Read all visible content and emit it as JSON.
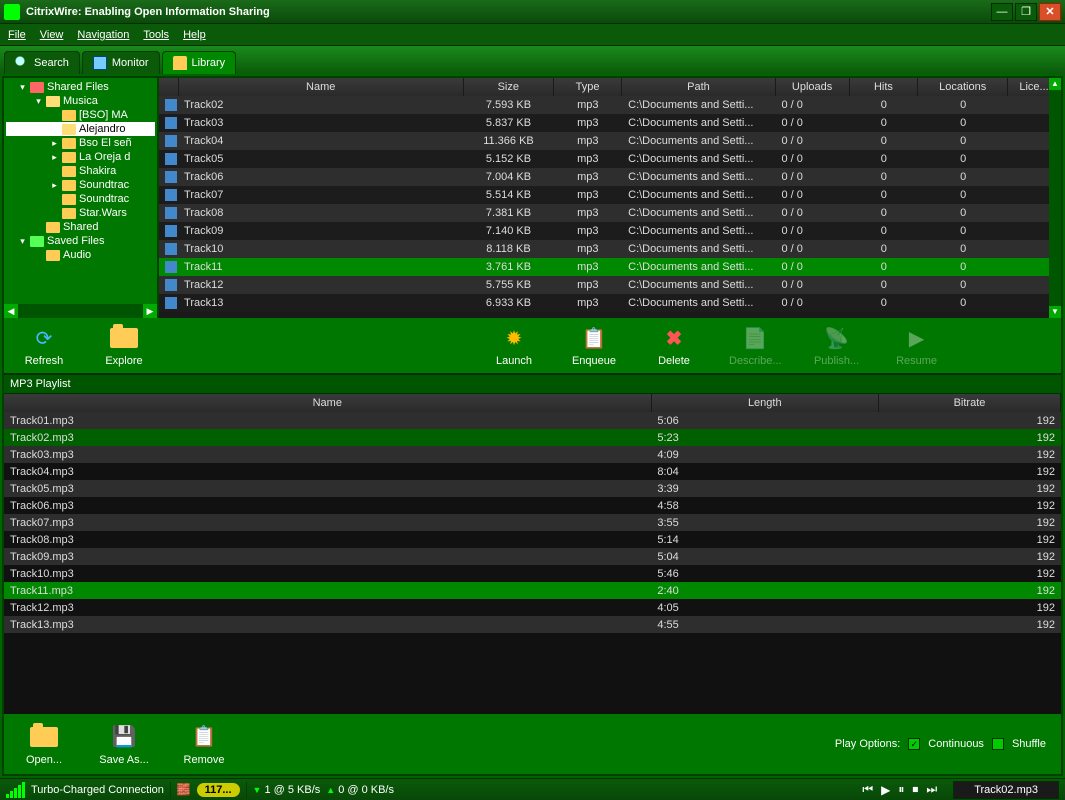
{
  "title": "CitrixWire: Enabling Open Information Sharing",
  "menu": {
    "file": "File",
    "view": "View",
    "nav": "Navigation",
    "tools": "Tools",
    "help": "Help"
  },
  "tabs": {
    "search": "Search",
    "monitor": "Monitor",
    "library": "Library"
  },
  "tree": {
    "shared": "Shared Files",
    "musica": "Musica",
    "bso": "[BSO] MA",
    "alejandro": "Alejandro",
    "bsoel": "Bso El señ",
    "laoreja": "La Oreja d",
    "shakira": "Shakira",
    "st1": "Soundtrac",
    "st2": "Soundtrac",
    "starwars": "Star.Wars",
    "shared2": "Shared",
    "saved": "Saved Files",
    "audio": "Audio"
  },
  "fileCols": {
    "name": "Name",
    "size": "Size",
    "type": "Type",
    "path": "Path",
    "uploads": "Uploads",
    "hits": "Hits",
    "locations": "Locations",
    "lice": "Lice..."
  },
  "files": [
    {
      "n": "Track02",
      "s": "7.593 KB",
      "t": "mp3",
      "p": "C:\\Documents and Setti...",
      "u": "0 / 0",
      "h": "0",
      "l": "0"
    },
    {
      "n": "Track03",
      "s": "5.837 KB",
      "t": "mp3",
      "p": "C:\\Documents and Setti...",
      "u": "0 / 0",
      "h": "0",
      "l": "0"
    },
    {
      "n": "Track04",
      "s": "11.366 KB",
      "t": "mp3",
      "p": "C:\\Documents and Setti...",
      "u": "0 / 0",
      "h": "0",
      "l": "0"
    },
    {
      "n": "Track05",
      "s": "5.152 KB",
      "t": "mp3",
      "p": "C:\\Documents and Setti...",
      "u": "0 / 0",
      "h": "0",
      "l": "0"
    },
    {
      "n": "Track06",
      "s": "7.004 KB",
      "t": "mp3",
      "p": "C:\\Documents and Setti...",
      "u": "0 / 0",
      "h": "0",
      "l": "0"
    },
    {
      "n": "Track07",
      "s": "5.514 KB",
      "t": "mp3",
      "p": "C:\\Documents and Setti...",
      "u": "0 / 0",
      "h": "0",
      "l": "0"
    },
    {
      "n": "Track08",
      "s": "7.381 KB",
      "t": "mp3",
      "p": "C:\\Documents and Setti...",
      "u": "0 / 0",
      "h": "0",
      "l": "0"
    },
    {
      "n": "Track09",
      "s": "7.140 KB",
      "t": "mp3",
      "p": "C:\\Documents and Setti...",
      "u": "0 / 0",
      "h": "0",
      "l": "0"
    },
    {
      "n": "Track10",
      "s": "8.118 KB",
      "t": "mp3",
      "p": "C:\\Documents and Setti...",
      "u": "0 / 0",
      "h": "0",
      "l": "0"
    },
    {
      "n": "Track11",
      "s": "3.761 KB",
      "t": "mp3",
      "p": "C:\\Documents and Setti...",
      "u": "0 / 0",
      "h": "0",
      "l": "0",
      "sel": true
    },
    {
      "n": "Track12",
      "s": "5.755 KB",
      "t": "mp3",
      "p": "C:\\Documents and Setti...",
      "u": "0 / 0",
      "h": "0",
      "l": "0"
    },
    {
      "n": "Track13",
      "s": "6.933 KB",
      "t": "mp3",
      "p": "C:\\Documents and Setti...",
      "u": "0 / 0",
      "h": "0",
      "l": "0"
    }
  ],
  "btns": {
    "refresh": "Refresh",
    "explore": "Explore",
    "launch": "Launch",
    "enqueue": "Enqueue",
    "delete": "Delete",
    "describe": "Describe...",
    "publish": "Publish...",
    "resume": "Resume"
  },
  "playlist": {
    "hdr": "MP3 Playlist",
    "cols": {
      "name": "Name",
      "length": "Length",
      "bitrate": "Bitrate"
    },
    "rows": [
      {
        "n": "Track01.mp3",
        "l": "5:06",
        "b": "192"
      },
      {
        "n": "Track02.mp3",
        "l": "5:23",
        "b": "192",
        "cur": true
      },
      {
        "n": "Track03.mp3",
        "l": "4:09",
        "b": "192"
      },
      {
        "n": "Track04.mp3",
        "l": "8:04",
        "b": "192"
      },
      {
        "n": "Track05.mp3",
        "l": "3:39",
        "b": "192"
      },
      {
        "n": "Track06.mp3",
        "l": "4:58",
        "b": "192"
      },
      {
        "n": "Track07.mp3",
        "l": "3:55",
        "b": "192"
      },
      {
        "n": "Track08.mp3",
        "l": "5:14",
        "b": "192"
      },
      {
        "n": "Track09.mp3",
        "l": "5:04",
        "b": "192"
      },
      {
        "n": "Track10.mp3",
        "l": "5:46",
        "b": "192"
      },
      {
        "n": "Track11.mp3",
        "l": "2:40",
        "b": "192",
        "sel": true
      },
      {
        "n": "Track12.mp3",
        "l": "4:05",
        "b": "192"
      },
      {
        "n": "Track13.mp3",
        "l": "4:55",
        "b": "192"
      }
    ]
  },
  "low": {
    "open": "Open...",
    "save": "Save As...",
    "remove": "Remove",
    "playopt": "Play Options:",
    "cont": "Continuous",
    "shuf": "Shuffle"
  },
  "status": {
    "conn": "Turbo-Charged Connection",
    "count": "117...",
    "dl": "1 @ 5 KB/s",
    "ul": "0 @ 0 KB/s",
    "now": "Track02.mp3"
  }
}
